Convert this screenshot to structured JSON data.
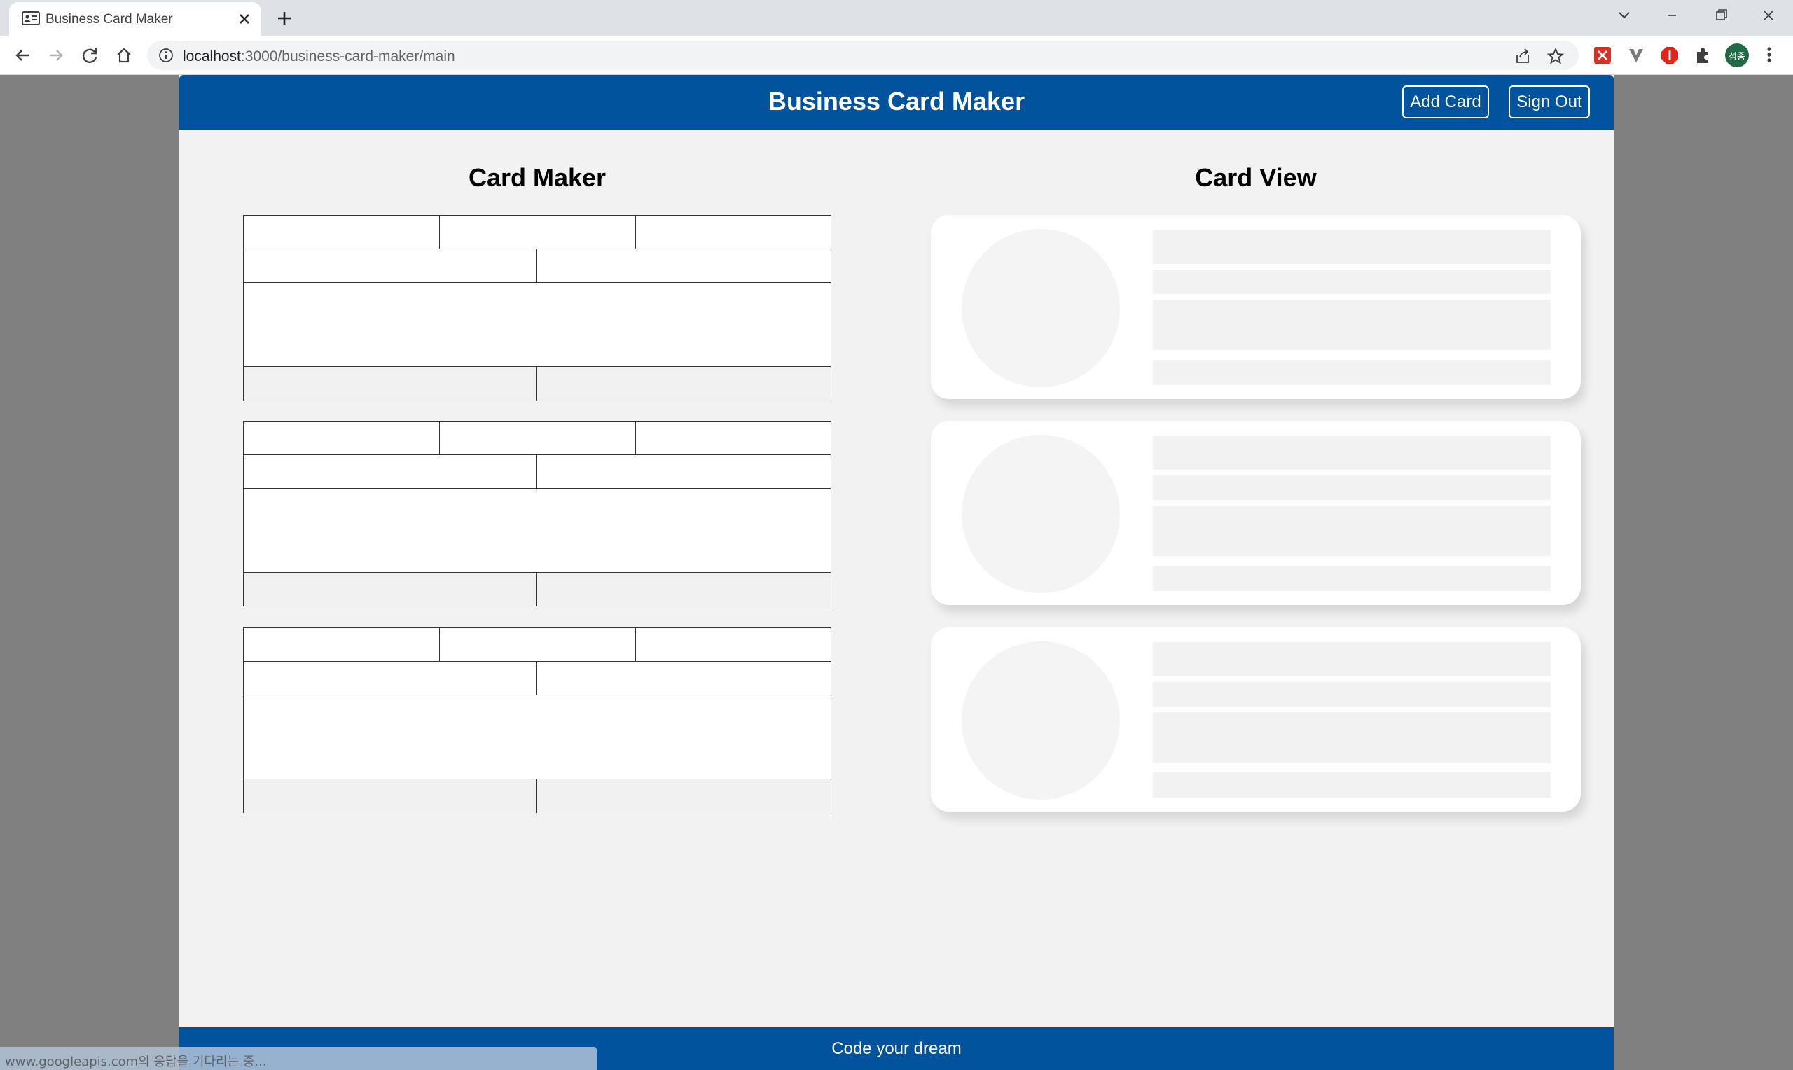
{
  "browser": {
    "tab_title": "Business Card Maker",
    "url_host": "localhost",
    "url_path": ":3000/business-card-maker/main",
    "profile_initials": "성종"
  },
  "app": {
    "title": "Business Card Maker",
    "add_card_label": "Add Card",
    "sign_out_label": "Sign Out",
    "maker_title": "Card Maker",
    "preview_title": "Card View",
    "footer": "Code your dream"
  },
  "status": {
    "text": "www.googleapis.com의 응답을 기다리는 중..."
  },
  "colors": {
    "brand": "#00539c",
    "app_background": "#f2f2f2",
    "page_background": "#808080"
  }
}
